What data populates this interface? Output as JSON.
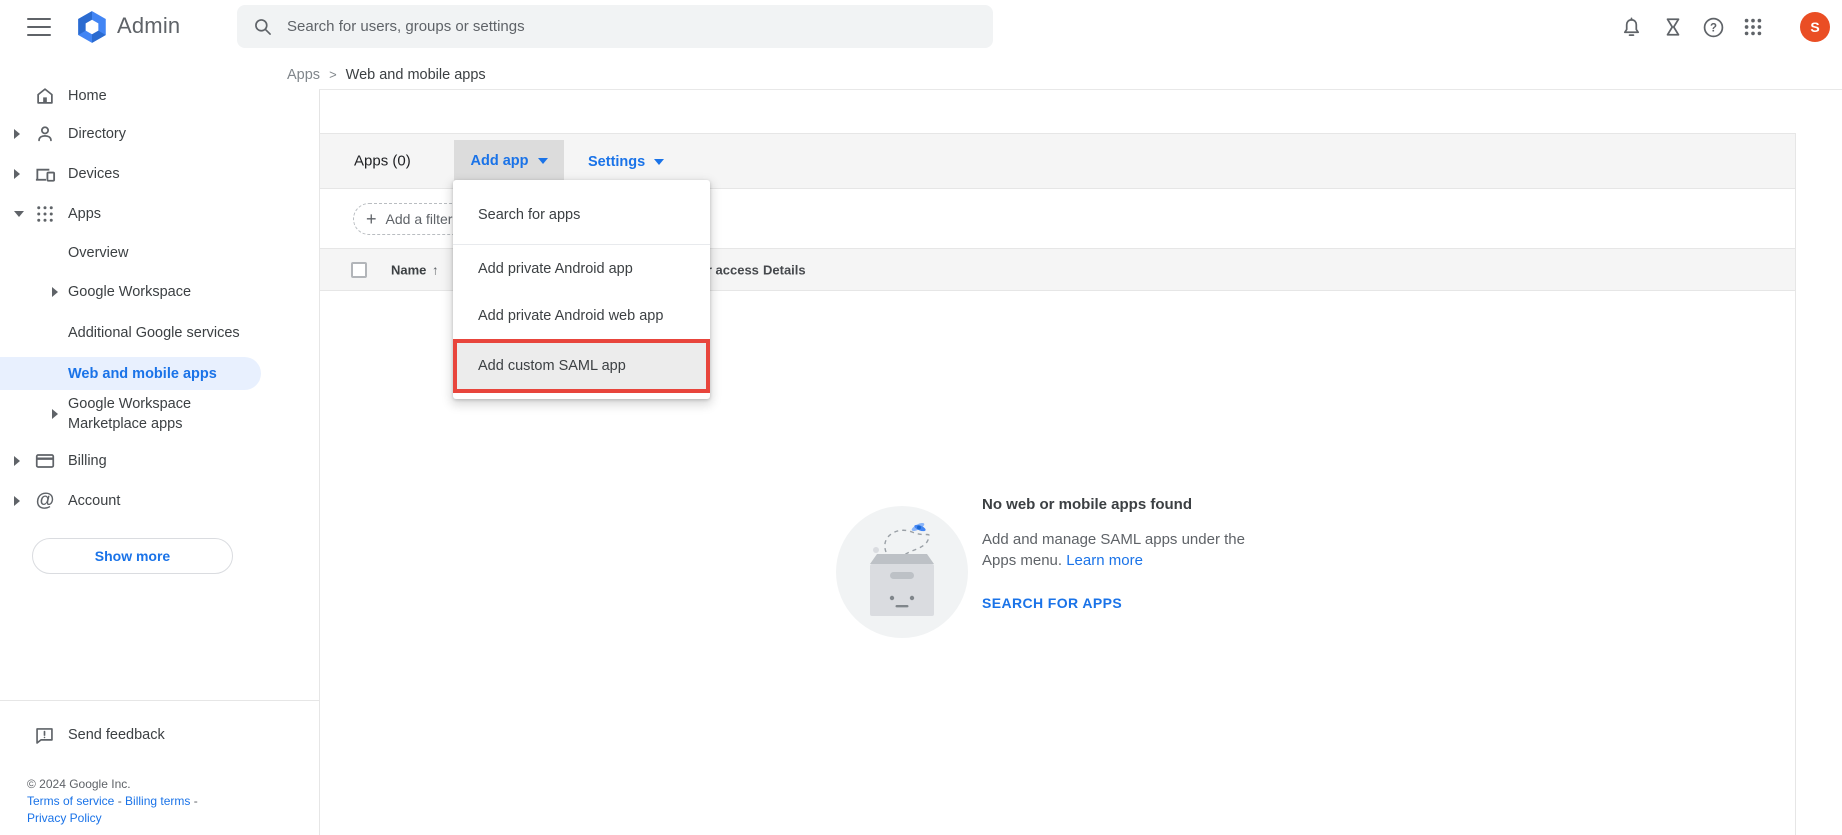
{
  "colors": {
    "accent": "#1a73e8",
    "selected_item_bg": "#e8f0fe",
    "highlight_border": "#e8453c",
    "avatar_bg": "#ea4e24",
    "bar_bg": "#f5f5f5"
  },
  "topbar": {
    "brand": "Admin",
    "search_placeholder": "Search for users, groups or settings",
    "icons": [
      "menu-icon",
      "search-icon",
      "notifications-icon",
      "hourglass-icon",
      "help-icon",
      "google-apps-grid-icon"
    ],
    "avatar_initial": "S"
  },
  "breadcrumb": {
    "parent": "Apps",
    "separator": ">",
    "current": "Web and mobile apps"
  },
  "sidebar": {
    "items": [
      {
        "label": "Home"
      },
      {
        "label": "Directory"
      },
      {
        "label": "Devices"
      },
      {
        "label": "Apps"
      }
    ],
    "apps_subitems": [
      {
        "label": "Overview"
      },
      {
        "label": "Google Workspace"
      },
      {
        "label": "Additional Google services"
      },
      {
        "label": "Web and mobile apps",
        "selected": true
      },
      {
        "label": "Google Workspace Marketplace apps"
      }
    ],
    "items_after": [
      {
        "label": "Billing"
      },
      {
        "label": "Account"
      }
    ],
    "show_more_label": "Show more",
    "send_feedback_label": "Send feedback",
    "footer": {
      "copyright": "© 2024 Google Inc.",
      "link1": "Terms of service",
      "sep1": " - ",
      "link2": "Billing terms",
      "sep2": " -",
      "link3": "Privacy Policy"
    }
  },
  "main": {
    "toolbar": {
      "title": "Apps (0)",
      "add_app_label": "Add app",
      "settings_label": "Settings"
    },
    "filter_chip_label": "Add a filter",
    "table_headers": {
      "name": "Name",
      "sort_arrow": "↑",
      "user_access": "User access",
      "details": "Details"
    },
    "menu": {
      "items": [
        "Search for apps",
        "Add private Android app",
        "Add private Android web app",
        "Add custom SAML app"
      ],
      "highlighted_item": "Add custom SAML app"
    },
    "empty_state": {
      "title": "No web or mobile apps found",
      "body": "Add and manage SAML apps under the Apps menu. ",
      "link_label": "Learn more",
      "action_label": "SEARCH FOR APPS"
    }
  }
}
